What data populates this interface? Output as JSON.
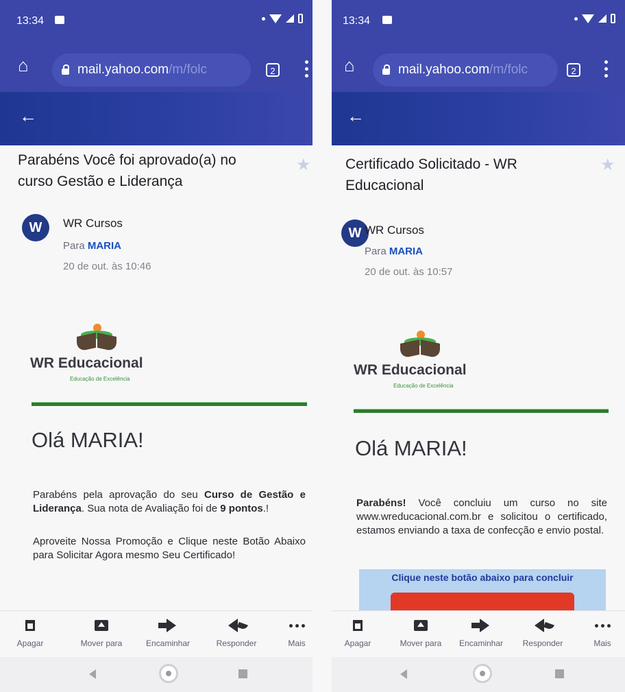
{
  "left": {
    "status": {
      "time": "13:34"
    },
    "browser": {
      "domain": "mail.yahoo.com",
      "path": "/m/folc",
      "tab_count": "2"
    },
    "email": {
      "subject": "Parabéns Você foi aprovado(a) no curso Gestão e Liderança",
      "sender": "WR Cursos",
      "to_prefix": "Para",
      "to_name": "MARIA",
      "date": "20 de out. às 10:46"
    },
    "body": {
      "brand": "WR Educacional",
      "tagline": "Educação de Excelência",
      "greeting": "Olá MARIA!",
      "p1_a": "Parabéns pela aprovação do seu ",
      "p1_b": "Curso de Gestão e Liderança",
      "p1_c": ". Sua nota de Avaliação foi de ",
      "p1_d": "9 pontos",
      "p1_e": ".!",
      "p2": "Aproveite Nossa Promoção e Clique neste Botão Abaixo para Solicitar Agora mesmo Seu Certificado!"
    },
    "actions": {
      "delete": "Apagar",
      "move": "Mover para",
      "forward": "Encaminhar",
      "reply": "Responder",
      "more": "Mais"
    }
  },
  "right": {
    "status": {
      "time": "13:34"
    },
    "browser": {
      "domain": "mail.yahoo.com",
      "path": "/m/folc",
      "tab_count": "2"
    },
    "email": {
      "subject": "Certificado Solicitado - WR Educacional",
      "sender": "WR Cursos",
      "to_prefix": "Para",
      "to_name": "MARIA",
      "date": "20 de out. às 10:57"
    },
    "body": {
      "brand": "WR Educacional",
      "tagline": "Educação de Excelência",
      "greeting": "Olá MARIA!",
      "p1_a": "Parabéns!",
      "p1_b": " Você concluiu um curso no site www.wreducacional.com.br e solicitou o certificado, estamos enviando a taxa de confecção e envio postal.",
      "cta_label": "Clique neste botão abaixo para concluir"
    },
    "actions": {
      "delete": "Apagar",
      "move": "Mover para",
      "forward": "Encaminhar",
      "reply": "Responder",
      "more": "Mais"
    }
  },
  "avatar_letter": "W",
  "colors": {
    "header": "#3b46a8",
    "appbar": "#1f3791",
    "link": "#1a4fbf",
    "rule": "#2c7d2c",
    "cta_bg": "#b6d3ef",
    "cta_button": "#e23826"
  }
}
